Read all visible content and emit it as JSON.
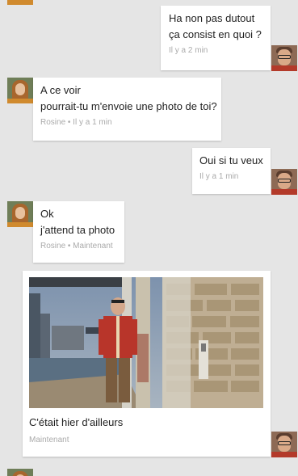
{
  "messages": [
    {
      "lines": [
        "Ha non pas dutout",
        "ça consist en quoi ?"
      ],
      "meta": "Il y a 2 min"
    },
    {
      "lines": [
        "A ce voir",
        "pourrait-tu m'envoie une photo de toi?"
      ],
      "meta": "Rosine • Il y a 1 min"
    },
    {
      "lines": [
        "Oui si tu veux"
      ],
      "meta": "Il y a 1 min"
    },
    {
      "lines": [
        "Ok",
        "j'attend ta photo"
      ],
      "meta": "Rosine • Maintenant"
    }
  ],
  "photo_message": {
    "caption": "C'était hier d'ailleurs",
    "meta": "Maintenant"
  },
  "avatars": {
    "me_icon": "user-avatar",
    "rosine_icon": "contact-avatar"
  },
  "colors": {
    "background": "#e5e5e5",
    "bubble": "#ffffff",
    "text": "#222222",
    "meta": "#aaaaaa"
  }
}
